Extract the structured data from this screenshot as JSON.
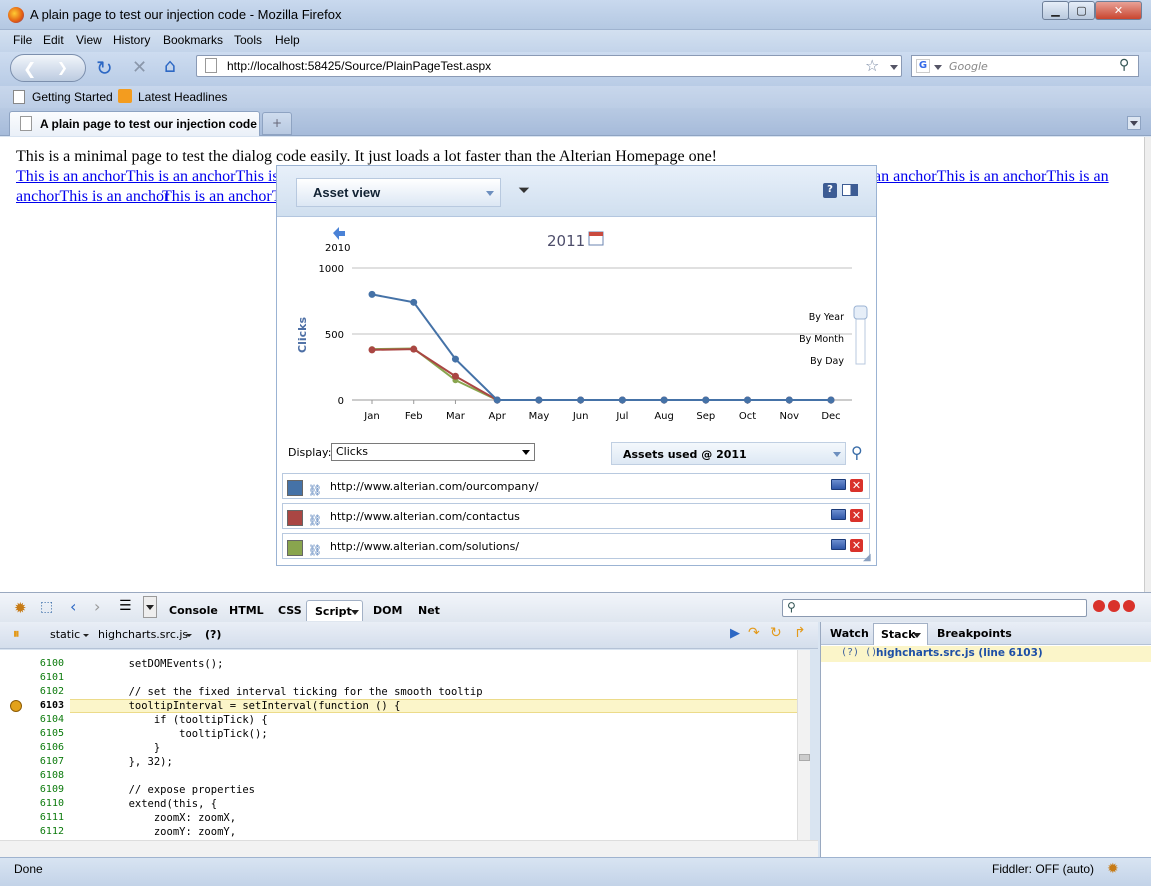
{
  "window": {
    "title": "A plain page to test our injection code - Mozilla Firefox",
    "minimize": "▁",
    "maximize": "▢",
    "close": "✕"
  },
  "menu": [
    "File",
    "Edit",
    "View",
    "History",
    "Bookmarks",
    "Tools",
    "Help"
  ],
  "nav": {
    "url": "http://localhost:58425/Source/PlainPageTest.aspx",
    "search_placeholder": "Google"
  },
  "bookmarks": [
    "Getting Started",
    "Latest Headlines"
  ],
  "tabs": [
    {
      "label": "A plain page to test our injection code"
    }
  ],
  "page": {
    "intro": "This is a minimal page to test the dialog code easily. It just loads a lot faster than the Alterian Homepage one!",
    "line2_left": "This is an anchorThis is an anchorThis is an",
    "line2_right": "an anchorThis is an anchorThis is an",
    "line3_a": "anchorThis is an anchor",
    "line3_b": "This is an anchorTh"
  },
  "dialog": {
    "view_select": "Asset view",
    "prev_year": "2010",
    "year": "2011",
    "display_label": "Display:",
    "display_value": "Clicks",
    "assets_used": "Assets used @ 2011",
    "zoom_options": [
      "By Year",
      "By Month",
      "By Day"
    ],
    "rows": [
      {
        "url": "http://www.alterian.com/ourcompany/",
        "color": "#4572a7"
      },
      {
        "url": "http://www.alterian.com/contactus",
        "color": "#aa4643"
      },
      {
        "url": "http://www.alterian.com/solutions/",
        "color": "#89a54e"
      }
    ]
  },
  "chart_data": {
    "type": "line",
    "title": "2011",
    "ylabel": "Clicks",
    "xlabel": "",
    "categories": [
      "Jan",
      "Feb",
      "Mar",
      "Apr",
      "May",
      "Jun",
      "Jul",
      "Aug",
      "Sep",
      "Oct",
      "Nov",
      "Dec"
    ],
    "ylim": [
      0,
      1000
    ],
    "yticks": [
      0,
      500,
      1000
    ],
    "series": [
      {
        "values": [
          800,
          740,
          310,
          0,
          0,
          0,
          0,
          0,
          0,
          0,
          0,
          0
        ],
        "color": "#4572a7"
      },
      {
        "values": [
          380,
          385,
          180,
          0,
          0,
          0,
          0,
          0,
          0,
          0,
          0,
          0
        ],
        "color": "#aa4643"
      },
      {
        "values": [
          385,
          390,
          150,
          0,
          0,
          0,
          0,
          0,
          0,
          0,
          0,
          0
        ],
        "color": "#89a54e"
      }
    ],
    "grid": true
  },
  "firebug": {
    "tabs": [
      "Console",
      "HTML",
      "CSS",
      "Script",
      "DOM",
      "Net"
    ],
    "script_selector": "static",
    "file_selector": "highcharts.src.js",
    "help": "(?)",
    "right_tabs": [
      "Watch",
      "Stack",
      "Breakpoints"
    ],
    "stack_entry": "(?) ()",
    "stack_link": "highcharts.src.js (line 6103)",
    "code_lines": [
      {
        "n": "6100",
        "t": "        setDOMEvents();"
      },
      {
        "n": "6101",
        "t": ""
      },
      {
        "n": "6102",
        "t": "        // set the fixed interval ticking for the smooth tooltip"
      },
      {
        "n": "6103",
        "t": "        tooltipInterval = setInterval(function () {"
      },
      {
        "n": "6104",
        "t": "            if (tooltipTick) {"
      },
      {
        "n": "6105",
        "t": "                tooltipTick();"
      },
      {
        "n": "6106",
        "t": "            }"
      },
      {
        "n": "6107",
        "t": "        }, 32);"
      },
      {
        "n": "6108",
        "t": ""
      },
      {
        "n": "6109",
        "t": "        // expose properties"
      },
      {
        "n": "6110",
        "t": "        extend(this, {"
      },
      {
        "n": "6111",
        "t": "            zoomX: zoomX,"
      },
      {
        "n": "6112",
        "t": "            zoomY: zoomY,"
      }
    ]
  },
  "status": {
    "left": "Done",
    "right": "Fiddler: OFF (auto)"
  }
}
